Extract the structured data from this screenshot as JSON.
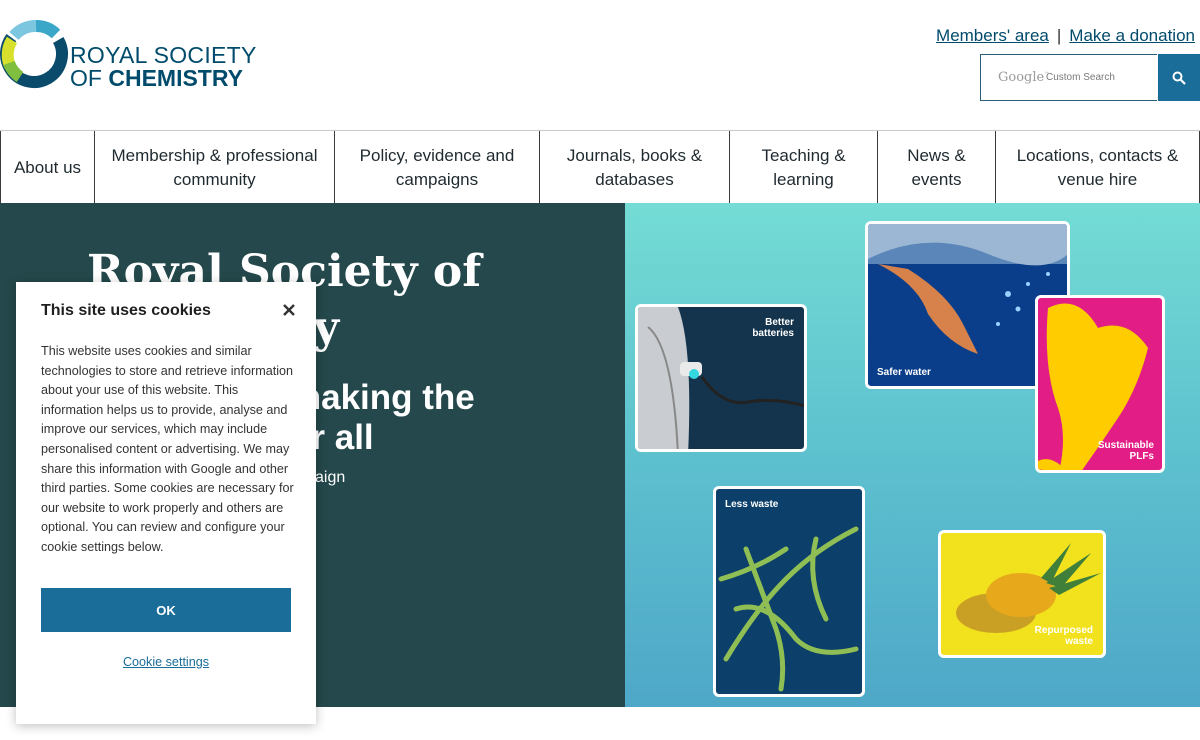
{
  "brand": {
    "line1": "ROYAL SOCIETY",
    "line2_prefix": "OF ",
    "line2_bold": "CHEMISTRY",
    "colors": {
      "primary": "#004b6b",
      "accent": "#1a6c99",
      "hero_dark": "#24484b"
    }
  },
  "top_links": {
    "members": "Members' area",
    "separator": "|",
    "donate": "Make a donation"
  },
  "search": {
    "google": "Google",
    "google_tm": "™",
    "custom": "Custom Search"
  },
  "nav": {
    "items": [
      {
        "label": "About us"
      },
      {
        "label": "Membership & professional community"
      },
      {
        "label": "Policy, evidence and campaigns"
      },
      {
        "label": "Journals, books & databases"
      },
      {
        "label": "Teaching & learning"
      },
      {
        "label": "News & events"
      },
      {
        "label": "Locations, contacts & venue hire"
      }
    ]
  },
  "hero": {
    "title": "Royal Society of Chemistry",
    "subtitle": "making the or all",
    "small": "aign",
    "cards": {
      "batteries": "Better batteries",
      "water": "Safer water",
      "plfs": "Sustainable PLFs",
      "waste": "Less waste",
      "repurposed": "Repurposed waste"
    }
  },
  "cookie": {
    "title": "This site uses cookies",
    "body": "This website uses cookies and similar technologies to store and retrieve information about your use of this website. This information helps us to provide, analyse and improve our services, which may include personalised content or advertising. We may share this information with Google and other third parties. Some cookies are necessary for our website to work properly and others are optional. You can review and configure your cookie settings below.",
    "ok": "OK",
    "settings": "Cookie settings",
    "close_icon": "close-icon"
  }
}
